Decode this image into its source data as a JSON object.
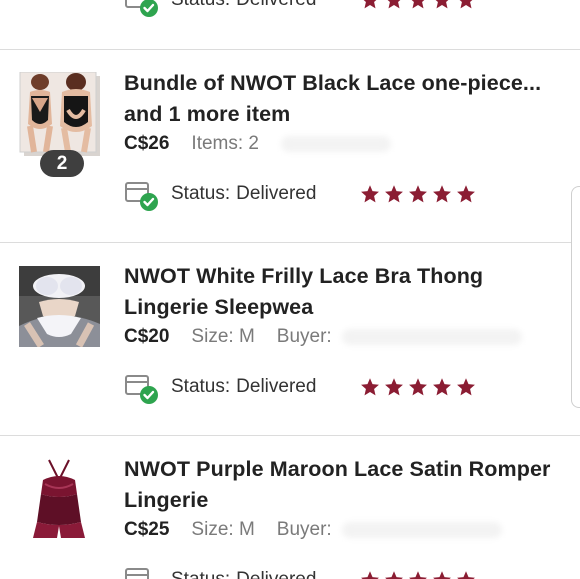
{
  "colors": {
    "star": "#8b1d33",
    "check": "#2ea44f",
    "divider": "#dcdcdc"
  },
  "orders": [
    {
      "title": "",
      "price": "",
      "status_label": "Status:",
      "status_value": "Delivered",
      "rating": 5
    },
    {
      "title": "Bundle of NWOT Black Lace one-piece... and 1 more item",
      "price": "C$26",
      "detail": "Items: 2",
      "bundle_count": "2",
      "status_label": "Status:",
      "status_value": "Delivered",
      "rating": 5,
      "thumb_icon": "black-lace-bodysuit-image"
    },
    {
      "title": "NWOT White Frilly Lace Bra Thong Lingerie Sleepwea",
      "price": "C$20",
      "detail": "Size: M",
      "buyer_label": "Buyer:",
      "status_label": "Status:",
      "status_value": "Delivered",
      "rating": 5,
      "thumb_icon": "white-lace-lingerie-image"
    },
    {
      "title": "NWOT Purple Maroon Lace Satin Romper Lingerie",
      "price": "C$25",
      "detail": "Size: M",
      "buyer_label": "Buyer:",
      "status_label": "Status:",
      "status_value": "Delivered",
      "rating": 5,
      "thumb_icon": "maroon-lace-romper-image"
    }
  ]
}
